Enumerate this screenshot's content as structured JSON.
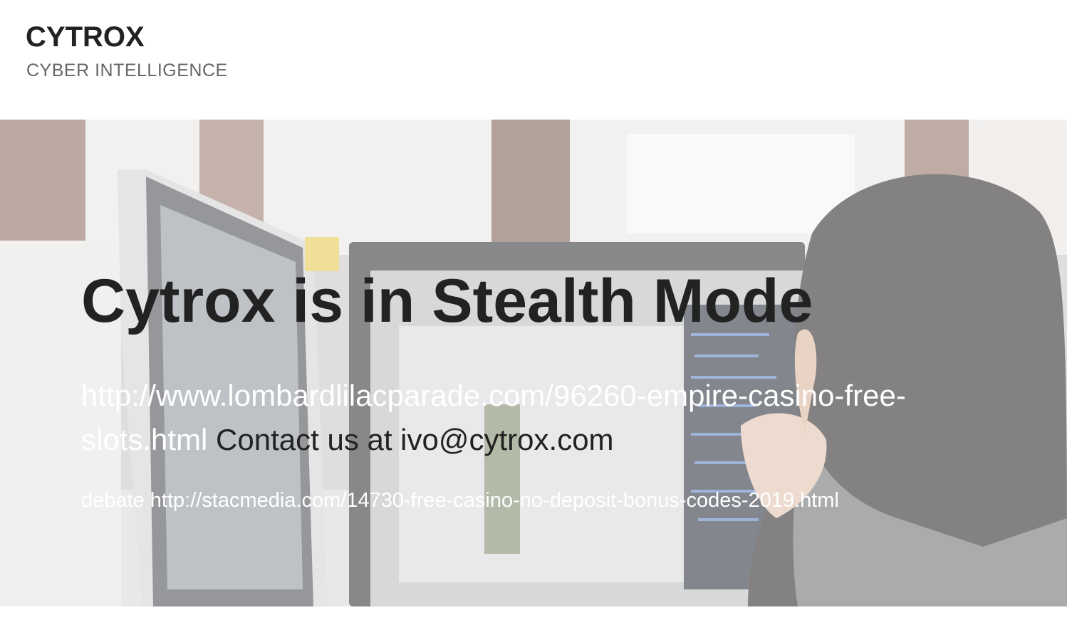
{
  "header": {
    "brand_name": "CYTROX",
    "tagline": "CYBER INTELLIGENCE"
  },
  "hero": {
    "title": "Cytrox is in Stealth Mode",
    "lead_link": "http://www.lombardlilacparade.com/96260-empire-casino-free-slots.html",
    "lead_text": " Contact us at ivo@cytrox.com",
    "sub_prefix": "debate ",
    "sub_link": "http://stacmedia.com/14730-free-casino-no-deposit-bonus-codes-2019.html"
  },
  "colors": {
    "text_dark": "#222222",
    "text_muted": "#666666",
    "hero_link": "#ffffff"
  }
}
